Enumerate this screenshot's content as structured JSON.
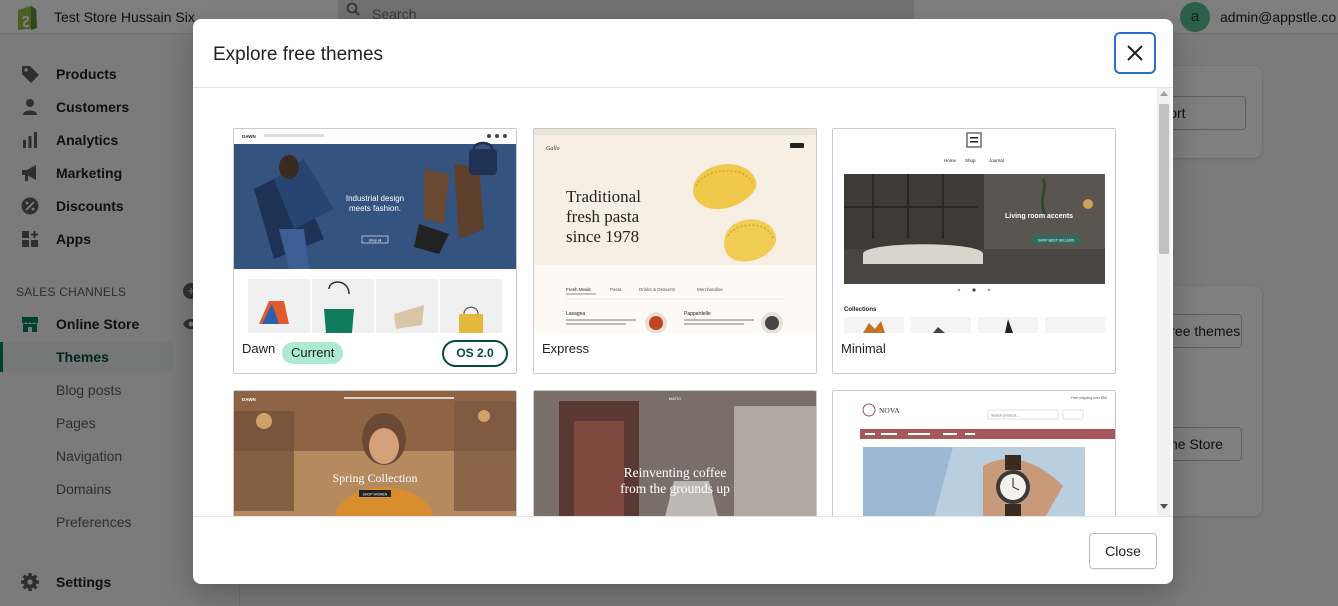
{
  "topbar": {
    "store_name": "Test Store Hussain Six",
    "search_placeholder": "Search",
    "avatar_initial": "a",
    "admin_email": "admin@appstle.co"
  },
  "sidebar": {
    "items": [
      {
        "label": "Products",
        "icon": "tag-icon"
      },
      {
        "label": "Customers",
        "icon": "person-icon"
      },
      {
        "label": "Analytics",
        "icon": "bar-chart-icon"
      },
      {
        "label": "Marketing",
        "icon": "megaphone-icon"
      },
      {
        "label": "Discounts",
        "icon": "discount-icon"
      },
      {
        "label": "Apps",
        "icon": "apps-icon"
      }
    ],
    "section_label": "SALES CHANNELS",
    "online_store": "Online Store",
    "sub_items": [
      "Themes",
      "Blog posts",
      "Pages",
      "Navigation",
      "Domains",
      "Preferences"
    ],
    "settings": "Settings"
  },
  "background": {
    "view_report": "View report",
    "themes_btn": "Explore free themes",
    "store_btn": "Visit Online Store"
  },
  "modal": {
    "title": "Explore free themes",
    "close_label": "Close",
    "themes": [
      {
        "name": "Dawn",
        "badge": "Current",
        "os_badge": "OS 2.0",
        "preview_text": [
          "DAWN",
          "Industrial design meets fashion.",
          "Shop all"
        ]
      },
      {
        "name": "Express",
        "preview_text": [
          "Gallo",
          "Traditional fresh pasta since 1978",
          "Fresh Meals",
          "Pasta",
          "Drinks & Desserts",
          "Merchandise",
          "Lasagna",
          "Pappardelle"
        ]
      },
      {
        "name": "Minimal",
        "preview_text": [
          "Home",
          "Shop",
          "Journal",
          "Living room accents",
          "SHOP BEST SELLERS",
          "Collections"
        ]
      },
      {
        "name": "",
        "preview_text": [
          "DAWN",
          "Spring Collection",
          "SHOP WOMEN"
        ]
      },
      {
        "name": "",
        "preview_text": [
          "MATIO",
          "Reinventing coffee from the grounds up"
        ]
      },
      {
        "name": "",
        "preview_text": [
          "NOVA",
          "Search products...",
          "Free shipping over $50"
        ]
      }
    ]
  },
  "colors": {
    "brand_green": "#008060",
    "current_badge": "#aee9d1",
    "focus_blue": "#2c6ecb"
  }
}
